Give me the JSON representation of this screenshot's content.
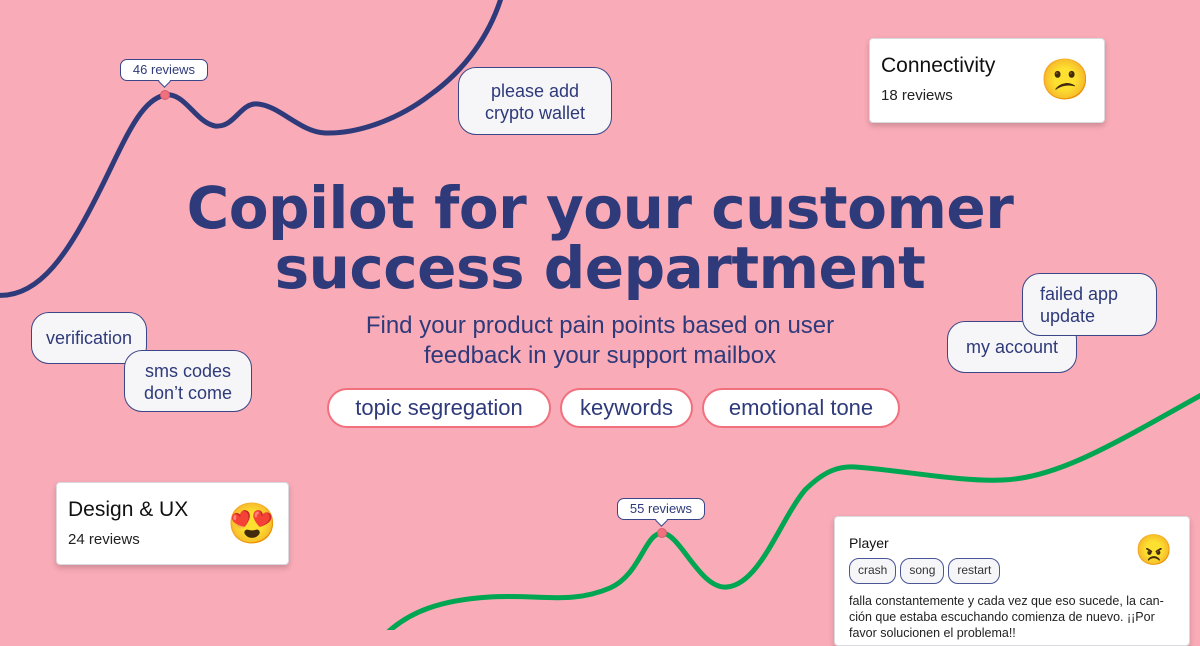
{
  "headline": {
    "line1": "Copilot for your customer",
    "line2": "success department"
  },
  "subheadline": {
    "line1": "Find your product pain points based on user",
    "line2": "feedback in your support mailbox"
  },
  "features": [
    "topic segregation",
    "keywords",
    "emotional tone"
  ],
  "bubbles": {
    "crypto": [
      "please add",
      "crypto wallet"
    ],
    "verification": "verification",
    "sms": [
      "sms codes",
      "don’t come"
    ],
    "failed_update": [
      "failed app",
      "update"
    ],
    "my_account": "my account"
  },
  "topic_cards": [
    {
      "title": "Connectivity",
      "reviews": "18 reviews",
      "emoji": "confused-face-icon",
      "glyph": "😕"
    },
    {
      "title": "Design & UX",
      "reviews": "24 reviews",
      "emoji": "heart-eyes-icon",
      "glyph": "😍"
    }
  ],
  "trend_tooltips": {
    "navy": "46 reviews",
    "green": "55 reviews"
  },
  "review_card": {
    "title": "Player",
    "tags": [
      "crash",
      "song",
      "restart"
    ],
    "emoji": "angry-face-icon",
    "glyph": "😠",
    "text_lines": [
      "falla constantemente y cada vez que eso sucede, la can-",
      "ción que estaba escuchando comienza de nuevo. ¡¡Por",
      "favor solucionen el problema!!"
    ]
  },
  "colors": {
    "background": "#f9abb7",
    "navy": "#2e3a7a",
    "green": "#00a651",
    "accent_border": "#f0707e"
  }
}
